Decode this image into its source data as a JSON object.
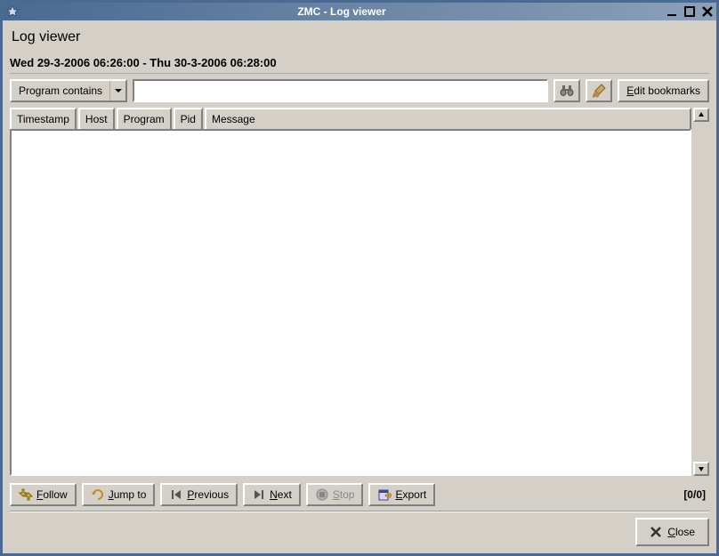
{
  "window": {
    "title": "ZMC - Log viewer"
  },
  "header": {
    "title": "Log viewer"
  },
  "date_range": "Wed 29-3-2006 06:26:00 - Thu 30-3-2006 06:28:00",
  "filter": {
    "mode": "Program contains",
    "text": "",
    "edit_bookmarks": "Edit bookmarks"
  },
  "columns": [
    "Timestamp",
    "Host",
    "Program",
    "Pid",
    "Message"
  ],
  "toolbar": {
    "follow": "Follow",
    "jump": "Jump to",
    "previous": "Previous",
    "next": "Next",
    "stop": "Stop",
    "export": "Export"
  },
  "status": {
    "count": "[0/0]"
  },
  "footer": {
    "close": "Close"
  }
}
